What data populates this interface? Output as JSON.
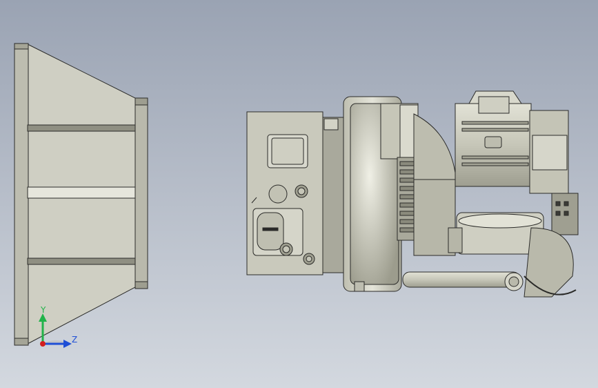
{
  "view": {
    "background_top": "#9aa3b3",
    "background_bottom": "#d3d8df",
    "model_tint": "#c8c8bb",
    "edge_color": "#2a2a28"
  },
  "triad": {
    "y_label": "Y",
    "z_label": "Z",
    "y_color": "#21b34a",
    "z_color": "#1f4fd6",
    "origin_color": "#d21f1f"
  },
  "icons": [
    "coordinate-triad-icon"
  ]
}
